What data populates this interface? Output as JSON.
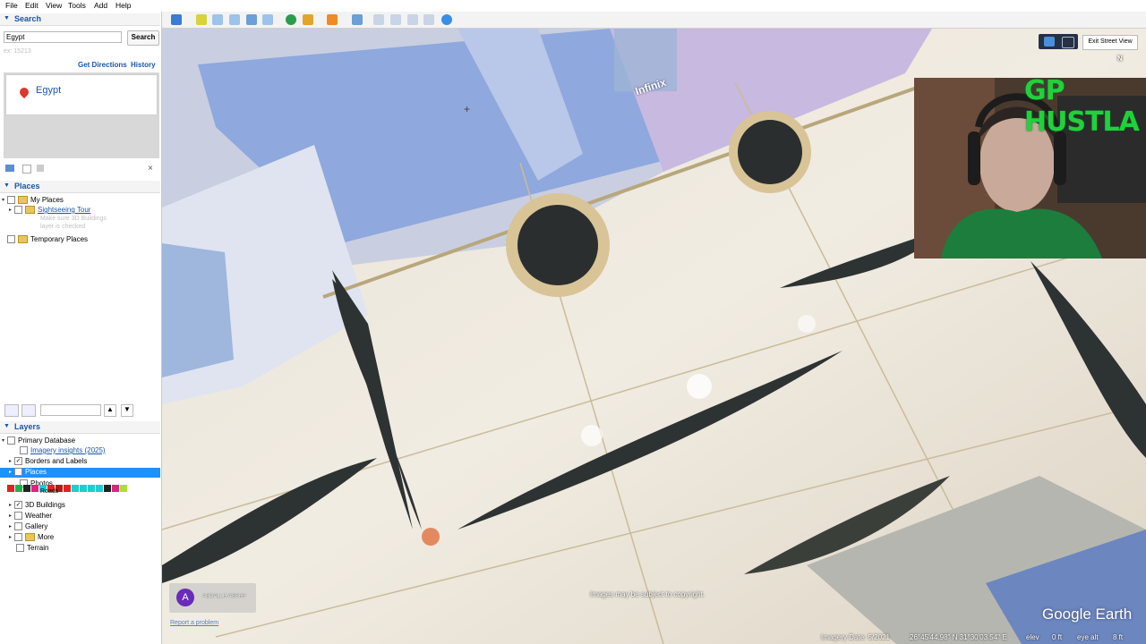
{
  "menu": [
    "File",
    "Edit",
    "View",
    "Tools",
    "Add",
    "Help"
  ],
  "search": {
    "header": "Search",
    "query": "Egypt",
    "button": "Search",
    "hint": "ex: 15213",
    "get_directions": "Get Directions",
    "history": "History",
    "result": "Egypt"
  },
  "places": {
    "header": "Places",
    "items": [
      "My Places",
      "Sightseeing Tour",
      "Make sure 3D Buildings",
      "layer is checked",
      "Temporary Places"
    ]
  },
  "layers": {
    "header": "Layers",
    "items": [
      "Primary Database",
      "Imagery insights (2025)",
      "Borders and Labels",
      "Places",
      "Photos",
      "Roads",
      "3D Buildings",
      "Weather",
      "Gallery",
      "More",
      "Terrain"
    ]
  },
  "streetview": {
    "exit_button": "Exit Street View",
    "compass": "N",
    "contributor_initial": "A",
    "contributor": "ABDALLH ASRHF",
    "report": "Report a problem",
    "copyright": "Images may be subject to copyright.",
    "brand": "Google Earth",
    "sign_text": "Infinix"
  },
  "status_bar": {
    "imagery_date": "Imagery Date: 5/2021",
    "coords": "26°45'44.98\" N   31°30'03.54\" E",
    "elev": "elev",
    "elev_value": "0 ft",
    "eye_alt": "eye alt",
    "eye_alt_value": "8 ft"
  },
  "webcam": {
    "overlay_text": "GP HUSTLA"
  },
  "colors": {
    "accent": "#1a56a8",
    "selection": "#1e90ff",
    "brand_green": "#22d13a"
  }
}
